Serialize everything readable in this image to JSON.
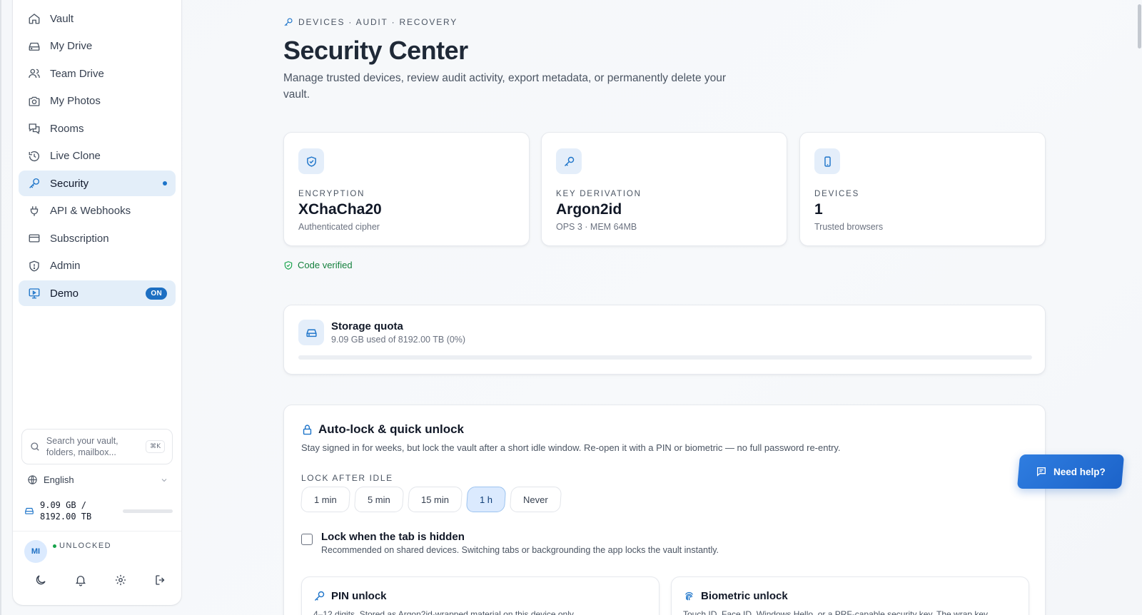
{
  "sidebar": {
    "items": [
      {
        "label": "Vault",
        "icon": "home-icon"
      },
      {
        "label": "My Drive",
        "icon": "drive-icon"
      },
      {
        "label": "Team Drive",
        "icon": "users-icon"
      },
      {
        "label": "My Photos",
        "icon": "camera-icon"
      },
      {
        "label": "Rooms",
        "icon": "chat-icon"
      },
      {
        "label": "Live Clone",
        "icon": "history-icon"
      },
      {
        "label": "Security",
        "icon": "key-icon"
      },
      {
        "label": "API & Webhooks",
        "icon": "plug-icon"
      },
      {
        "label": "Subscription",
        "icon": "card-icon"
      },
      {
        "label": "Admin",
        "icon": "shield-icon"
      },
      {
        "label": "Demo",
        "icon": "monitor-icon",
        "badge": "ON"
      }
    ],
    "search_placeholder": "Search your vault, folders, mailbox...",
    "search_shortcut": "⌘K",
    "language": "English",
    "storage_text": "9.09 GB / 8192.00 TB",
    "avatar_initials": "MI",
    "status": "UNLOCKED"
  },
  "header": {
    "eyebrow": "DEVICES · AUDIT · RECOVERY",
    "title": "Security Center",
    "subtitle": "Manage trusted devices, review audit activity, export metadata, or permanently delete your vault."
  },
  "stats": [
    {
      "label": "ENCRYPTION",
      "value": "XChaCha20",
      "sub": "Authenticated cipher",
      "icon": "shield-check-icon"
    },
    {
      "label": "KEY DERIVATION",
      "value": "Argon2id",
      "sub": "OPS 3 · MEM 64MB",
      "icon": "key-icon"
    },
    {
      "label": "DEVICES",
      "value": "1",
      "sub": "Trusted browsers",
      "icon": "phone-icon"
    }
  ],
  "verified": "Code verified",
  "quota": {
    "title": "Storage quota",
    "sub": "9.09 GB used of 8192.00 TB (0%)",
    "percent": 0
  },
  "autolock": {
    "title": "Auto-lock & quick unlock",
    "desc": "Stay signed in for weeks, but lock the vault after a short idle window. Re-open it with a PIN or biometric — no full password re-entry.",
    "lock_label": "LOCK AFTER IDLE",
    "options": [
      "1 min",
      "5 min",
      "15 min",
      "1 h",
      "Never"
    ],
    "selected": "1 h",
    "tab_hidden_title": "Lock when the tab is hidden",
    "tab_hidden_sub": "Recommended on shared devices. Switching tabs or backgrounding the app locks the vault instantly.",
    "pin_title": "PIN unlock",
    "pin_sub": "4–12 digits. Stored as Argon2id-wrapped material on this device only.",
    "bio_title": "Biometric unlock",
    "bio_sub": "Touch ID, Face ID, Windows Hello, or a PRF-capable security key. The wrap key..."
  },
  "help_label": "Need help?",
  "colors": {
    "accent": "#1d74c9",
    "success": "#16a34a"
  }
}
